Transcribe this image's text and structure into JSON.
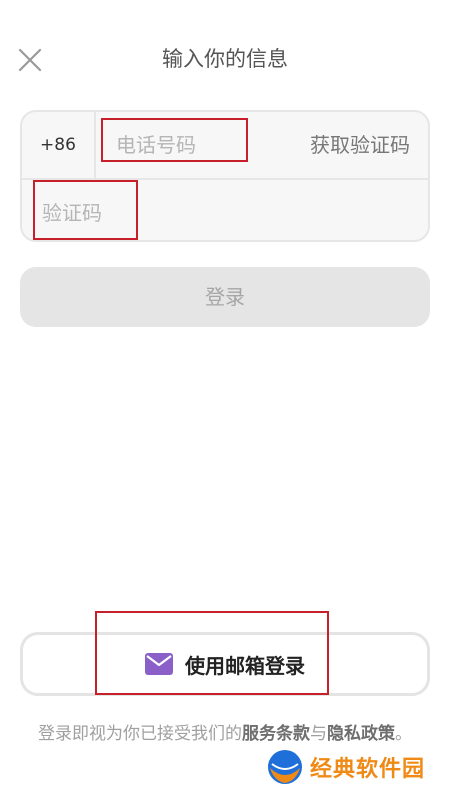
{
  "header": {
    "title": "输入你的信息",
    "close_icon": "close-icon"
  },
  "form": {
    "country_code": "+86",
    "phone_placeholder": "电话号码",
    "get_code_label": "获取验证码",
    "code_placeholder": "验证码"
  },
  "login_button": {
    "label": "登录"
  },
  "email_login": {
    "label": "使用邮箱登录",
    "icon": "mail-icon",
    "icon_color": "#8a5fc7"
  },
  "terms": {
    "prefix": "登录即视为你已接受我们的",
    "service_terms": "服务条款",
    "connector": "与",
    "privacy_policy": "隐私政策",
    "suffix": "。"
  },
  "watermark": {
    "text": "经典软件园",
    "color": "#f08a17"
  }
}
